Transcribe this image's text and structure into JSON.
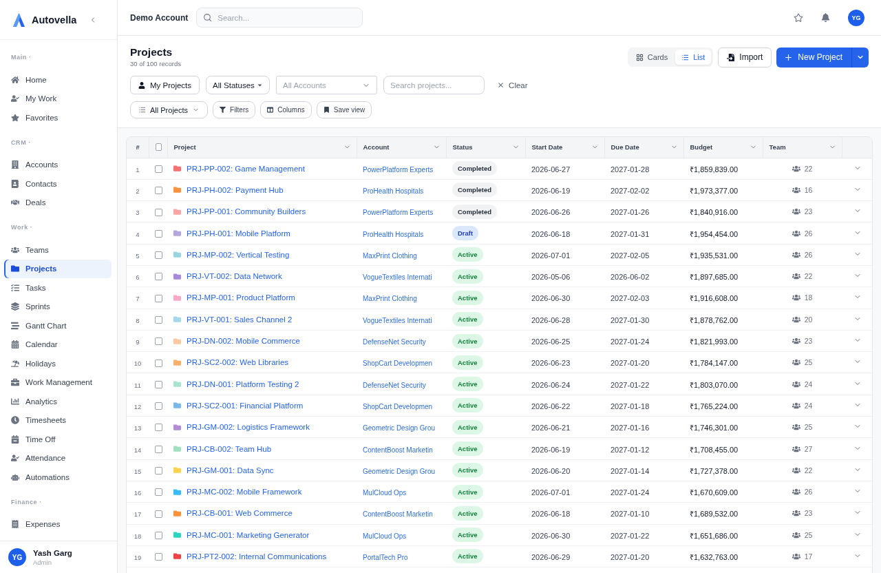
{
  "sidebar": {
    "brand": "Autovella",
    "sections": [
      {
        "label": "Main ·",
        "items": [
          {
            "label": "Home",
            "selected": false
          },
          {
            "label": "My Work",
            "selected": false
          },
          {
            "label": "Favorites",
            "selected": false
          }
        ]
      },
      {
        "label": "CRM ·",
        "items": [
          {
            "label": "Accounts",
            "selected": false
          },
          {
            "label": "Contacts",
            "selected": false
          },
          {
            "label": "Deals",
            "selected": false
          }
        ]
      },
      {
        "label": "Work ·",
        "items": [
          {
            "label": "Teams",
            "selected": false
          },
          {
            "label": "Projects",
            "selected": true
          },
          {
            "label": "Tasks",
            "selected": false
          },
          {
            "label": "Sprints",
            "selected": false
          },
          {
            "label": "Gantt Chart",
            "selected": false
          },
          {
            "label": "Calendar",
            "selected": false
          },
          {
            "label": "Holidays",
            "selected": false
          },
          {
            "label": "Work Management",
            "selected": false
          },
          {
            "label": "Analytics",
            "selected": false
          },
          {
            "label": "Timesheets",
            "selected": false
          },
          {
            "label": "Time Off",
            "selected": false
          },
          {
            "label": "Attendance",
            "selected": false
          },
          {
            "label": "Automations",
            "selected": false
          }
        ]
      },
      {
        "label": "Finance ·",
        "items": [
          {
            "label": "Expenses",
            "selected": false
          }
        ]
      }
    ],
    "user": {
      "initials": "YG",
      "name": "Yash Garg",
      "role": "Admin"
    }
  },
  "topbar": {
    "account": "Demo Account",
    "search": {
      "placeholder": "Search..."
    },
    "avatar": "YG"
  },
  "page": {
    "title": "Projects",
    "subtitle": "30 of 100 records",
    "views": [
      {
        "label": "Cards",
        "selected": false
      },
      {
        "label": "List",
        "selected": true
      }
    ],
    "import": "Import",
    "new_project": "New Project"
  },
  "filters": {
    "my_projects": "My Projects",
    "status_select": "All Statuses",
    "account_select": {
      "placeholder": "All Accounts"
    },
    "search": {
      "placeholder": "Search projects..."
    },
    "clear": "Clear",
    "view_select": "All Projects",
    "filters": "Filters",
    "columns": "Columns",
    "save_view": "Save view"
  },
  "table": {
    "columns": [
      "#",
      "Project",
      "Account",
      "Status",
      "Start Date",
      "Due Date",
      "Budget",
      "Team"
    ],
    "select_all": {
      "checked": false
    },
    "rows": [
      {
        "number": "1",
        "checked": false,
        "color": "#f87171",
        "project": "PRJ-PP-002: Game Management",
        "account": "PowerPlatform Experts",
        "status": {
          "label": "Completed",
          "kind": "completed"
        },
        "start": "2026-06-27",
        "due": "2027-01-28",
        "budget": "₹1,859,839.00",
        "team": "22"
      },
      {
        "number": "2",
        "checked": false,
        "color": "#fb923c",
        "project": "PRJ-PH-002: Payment Hub",
        "account": "ProHealth Hospitals",
        "status": {
          "label": "Completed",
          "kind": "completed"
        },
        "start": "2026-06-19",
        "due": "2027-02-02",
        "budget": "₹1,973,377.00",
        "team": "16"
      },
      {
        "number": "3",
        "checked": false,
        "color": "#fca5a5",
        "project": "PRJ-PP-001: Community Builders",
        "account": "PowerPlatform Experts",
        "status": {
          "label": "Completed",
          "kind": "completed"
        },
        "start": "2026-06-26",
        "due": "2027-01-26",
        "budget": "₹1,840,916.00",
        "team": "23"
      },
      {
        "number": "4",
        "checked": false,
        "color": "#b4a7e0",
        "project": "PRJ-PH-001: Mobile Platform",
        "account": "ProHealth Hospitals",
        "status": {
          "label": "Draft",
          "kind": "draft"
        },
        "start": "2026-06-18",
        "due": "2027-01-31",
        "budget": "₹1,954,454.00",
        "team": "26"
      },
      {
        "number": "5",
        "checked": false,
        "color": "#99d5e0",
        "project": "PRJ-MP-002: Vertical Testing",
        "account": "MaxPrint Clothing",
        "status": {
          "label": "Active",
          "kind": "active"
        },
        "start": "2026-07-01",
        "due": "2027-02-05",
        "budget": "₹1,935,531.00",
        "team": "26"
      },
      {
        "number": "6",
        "checked": false,
        "color": "#a78bda",
        "project": "PRJ-VT-002: Data Network",
        "account": "VogueTextiles Internati",
        "status": {
          "label": "Active",
          "kind": "active"
        },
        "start": "2026-05-06",
        "due": "2026-06-02",
        "budget": "₹1,897,685.00",
        "team": "22"
      },
      {
        "number": "7",
        "checked": false,
        "color": "#f9a8c7",
        "project": "PRJ-MP-001: Product Platform",
        "account": "MaxPrint Clothing",
        "status": {
          "label": "Active",
          "kind": "active"
        },
        "start": "2026-06-30",
        "due": "2027-02-03",
        "budget": "₹1,916,608.00",
        "team": "18"
      },
      {
        "number": "8",
        "checked": false,
        "color": "#a5d8ea",
        "project": "PRJ-VT-001: Sales Channel 2",
        "account": "VogueTextiles Internati",
        "status": {
          "label": "Active",
          "kind": "active"
        },
        "start": "2026-06-28",
        "due": "2027-01-30",
        "budget": "₹1,878,762.00",
        "team": "20"
      },
      {
        "number": "9",
        "checked": false,
        "color": "#fdc9a0",
        "project": "PRJ-DN-002: Mobile Commerce",
        "account": "DefenseNet Security",
        "status": {
          "label": "Active",
          "kind": "active"
        },
        "start": "2026-06-25",
        "due": "2027-01-24",
        "budget": "₹1,821,993.00",
        "team": "23"
      },
      {
        "number": "10",
        "checked": false,
        "color": "#fbb06a",
        "project": "PRJ-SC2-002: Web Libraries",
        "account": "ShopCart Developmen",
        "status": {
          "label": "Active",
          "kind": "active"
        },
        "start": "2026-06-23",
        "due": "2027-01-20",
        "budget": "₹1,784,147.00",
        "team": "25"
      },
      {
        "number": "11",
        "checked": false,
        "color": "#a7e3cf",
        "project": "PRJ-DN-001: Platform Testing 2",
        "account": "DefenseNet Security",
        "status": {
          "label": "Active",
          "kind": "active"
        },
        "start": "2026-06-24",
        "due": "2027-01-22",
        "budget": "₹1,803,070.00",
        "team": "24"
      },
      {
        "number": "12",
        "checked": false,
        "color": "#7ab8e8",
        "project": "PRJ-SC2-001: Financial Platform",
        "account": "ShopCart Developmen",
        "status": {
          "label": "Active",
          "kind": "active"
        },
        "start": "2026-06-22",
        "due": "2027-01-18",
        "budget": "₹1,765,224.00",
        "team": "24"
      },
      {
        "number": "13",
        "checked": false,
        "color": "#b28dd6",
        "project": "PRJ-GM-002: Logistics Framework",
        "account": "Geometric Design Grou",
        "status": {
          "label": "Active",
          "kind": "active"
        },
        "start": "2026-06-21",
        "due": "2027-01-16",
        "budget": "₹1,746,301.00",
        "team": "25"
      },
      {
        "number": "14",
        "checked": false,
        "color": "#a3e0c0",
        "project": "PRJ-CB-002: Team Hub",
        "account": "ContentBoost Marketin",
        "status": {
          "label": "Active",
          "kind": "active"
        },
        "start": "2026-06-19",
        "due": "2027-01-12",
        "budget": "₹1,708,455.00",
        "team": "27"
      },
      {
        "number": "15",
        "checked": false,
        "color": "#fcd34d",
        "project": "PRJ-GM-001: Data Sync",
        "account": "Geometric Design Grou",
        "status": {
          "label": "Active",
          "kind": "active"
        },
        "start": "2026-06-20",
        "due": "2027-01-14",
        "budget": "₹1,727,378.00",
        "team": "22"
      },
      {
        "number": "16",
        "checked": false,
        "color": "#38bdf8",
        "project": "PRJ-MC-002: Mobile Framework",
        "account": "MulCloud Ops",
        "status": {
          "label": "Active",
          "kind": "active"
        },
        "start": "2026-07-01",
        "due": "2027-01-24",
        "budget": "₹1,670,609.00",
        "team": "26"
      },
      {
        "number": "17",
        "checked": false,
        "color": "#fb923c",
        "project": "PRJ-CB-001: Web Commerce",
        "account": "ContentBoost Marketin",
        "status": {
          "label": "Active",
          "kind": "active"
        },
        "start": "2026-06-18",
        "due": "2027-01-10",
        "budget": "₹1,689,532.00",
        "team": "23"
      },
      {
        "number": "18",
        "checked": false,
        "color": "#2dd4bf",
        "project": "PRJ-MC-001: Marketing Generator",
        "account": "MulCloud Ops",
        "status": {
          "label": "Active",
          "kind": "active"
        },
        "start": "2026-06-30",
        "due": "2027-01-22",
        "budget": "₹1,651,686.00",
        "team": "25"
      },
      {
        "number": "19",
        "checked": false,
        "color": "#ef4444",
        "project": "PRJ-PT2-002: Internal Communications",
        "account": "PortalTech Pro",
        "status": {
          "label": "Active",
          "kind": "active"
        },
        "start": "2026-06-29",
        "due": "2027-01-20",
        "budget": "₹1,632,763.00",
        "team": "17"
      }
    ]
  }
}
